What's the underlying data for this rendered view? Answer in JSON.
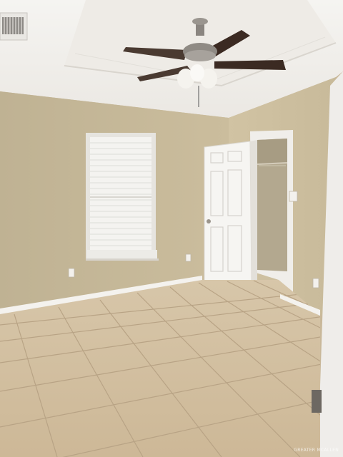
{
  "scene": {
    "subject": "empty-bedroom",
    "colors": {
      "ceiling": "#f2f0ec",
      "tray_ceiling": "#e9e6e1",
      "wall_back": "#c4b697",
      "wall_right": "#cdbf9f",
      "baseboard": "#f4f2ee",
      "floor_tile": "#d9c7a8",
      "grout": "#b8a385",
      "window_blind": "#f3f2ef",
      "door": "#f7f6f3",
      "fan_blade": "#3b2a22",
      "fan_metal": "#8a8580"
    }
  },
  "watermark": {
    "text": "GREATER MCALLEN"
  }
}
